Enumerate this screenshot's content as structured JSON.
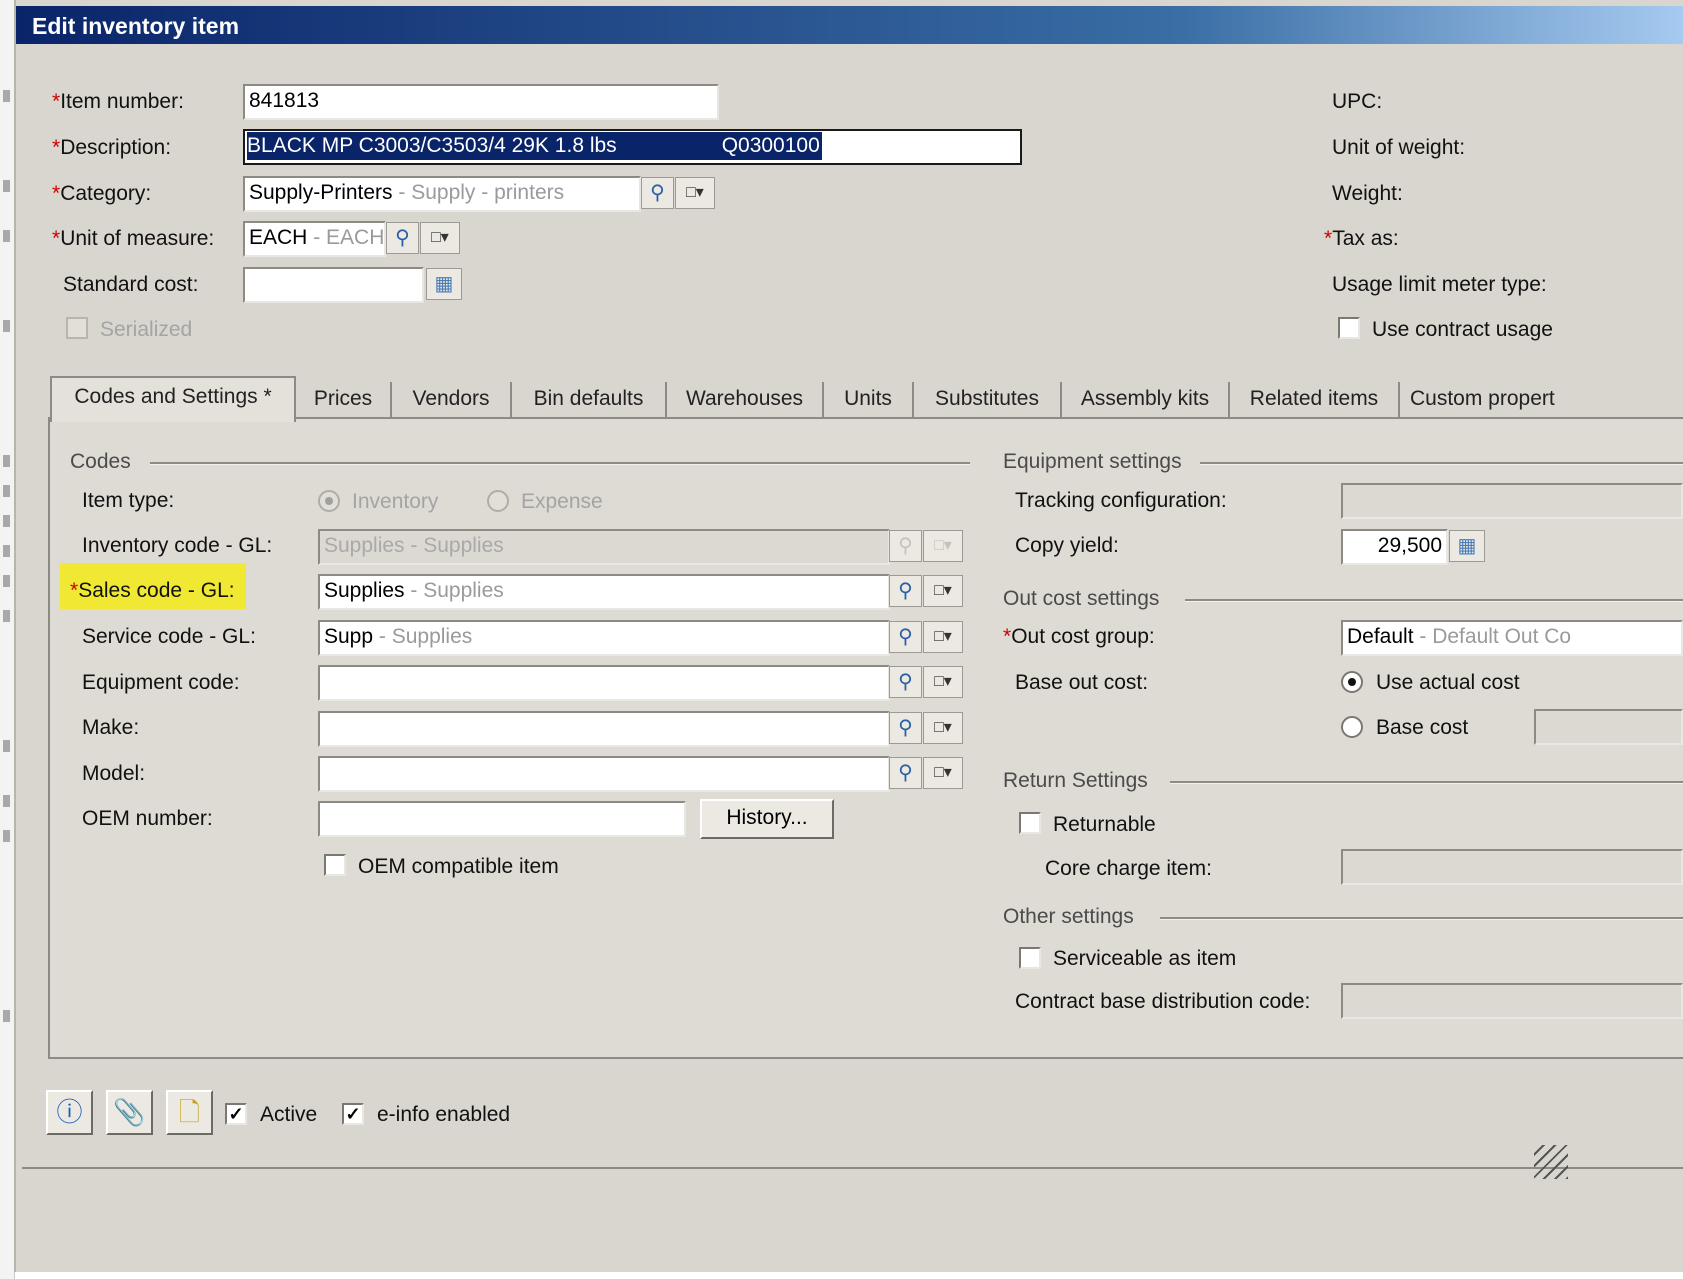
{
  "window": {
    "title": "Edit inventory item"
  },
  "header": {
    "item_number": {
      "label": "Item number:",
      "value": "841813"
    },
    "description": {
      "label": "Description:",
      "value": "BLACK  MP C3003/C3503/4  29K  1.8 lbs",
      "value_code": "Q0300100"
    },
    "category": {
      "label": "Category:",
      "code": "Supply-Printers",
      "name": " - Supply - printers"
    },
    "unit_of_measure": {
      "label": "Unit of measure:",
      "code": "EACH",
      "name": " - EACH"
    },
    "standard_cost": {
      "label": "Standard cost:",
      "value": ""
    },
    "serialized": {
      "label": "Serialized",
      "checked": false
    },
    "right": {
      "upc": "UPC:",
      "unit_of_weight": "Unit of weight:",
      "weight": "Weight:",
      "tax_as": "Tax as:",
      "usage_limit": "Usage limit meter type:",
      "use_contract_usage": "Use contract usage"
    }
  },
  "tabs": [
    {
      "label": "Codes and Settings *",
      "active": true
    },
    {
      "label": "Prices"
    },
    {
      "label": "Vendors"
    },
    {
      "label": "Bin defaults"
    },
    {
      "label": "Warehouses"
    },
    {
      "label": "Units"
    },
    {
      "label": "Substitutes"
    },
    {
      "label": "Assembly kits"
    },
    {
      "label": "Related items"
    },
    {
      "label": "Custom propert"
    }
  ],
  "codes": {
    "section_title": "Codes",
    "item_type": {
      "label": "Item type:",
      "option_inventory": "Inventory",
      "option_expense": "Expense",
      "selected": "Inventory"
    },
    "inventory_code": {
      "label": "Inventory code - GL:",
      "code": "Supplies",
      "name": " - Supplies"
    },
    "sales_code": {
      "label": "Sales code - GL:",
      "code": "Supplies",
      "name": " - Supplies",
      "highlight": "#f0e832"
    },
    "service_code": {
      "label": "Service code - GL:",
      "code": "Supp",
      "name": " - Supplies"
    },
    "equipment_code": {
      "label": "Equipment code:",
      "value": ""
    },
    "make": {
      "label": "Make:",
      "value": ""
    },
    "model": {
      "label": "Model:",
      "value": ""
    },
    "oem_number": {
      "label": "OEM number:",
      "value": "",
      "history_button": "History..."
    },
    "oem_compatible": {
      "label": "OEM compatible item",
      "checked": false
    }
  },
  "equipment": {
    "section_title": "Equipment settings",
    "tracking_configuration": {
      "label": "Tracking configuration:",
      "value": ""
    },
    "copy_yield": {
      "label": "Copy yield:",
      "value": "29,500"
    }
  },
  "out_cost": {
    "section_title": "Out cost settings",
    "group": {
      "label": "Out cost group:",
      "code": "Default",
      "name": " - Default Out Co"
    },
    "base_out_cost": {
      "label": "Base out cost:",
      "option_actual": "Use actual cost",
      "option_base": "Base cost",
      "selected": "Use actual cost"
    }
  },
  "return": {
    "section_title": "Return Settings",
    "returnable": {
      "label": "Returnable",
      "checked": false
    },
    "core_charge_item": {
      "label": "Core charge item:",
      "value": ""
    }
  },
  "other": {
    "section_title": "Other settings",
    "serviceable": {
      "label": "Serviceable as item",
      "checked": false
    },
    "contract_base": {
      "label": "Contract base distribution code:",
      "value": ""
    }
  },
  "footer": {
    "active": {
      "label": "Active",
      "checked": true
    },
    "einfo": {
      "label": "e-info enabled",
      "checked": true
    },
    "icons": [
      "info-icon",
      "attachment-icon",
      "note-icon"
    ]
  },
  "colors": {
    "title_start": "#0a246a",
    "title_end": "#a6caf0",
    "selection": "#0a246a",
    "required": "#d00000",
    "dialog_bg": "#d9d6cf"
  }
}
